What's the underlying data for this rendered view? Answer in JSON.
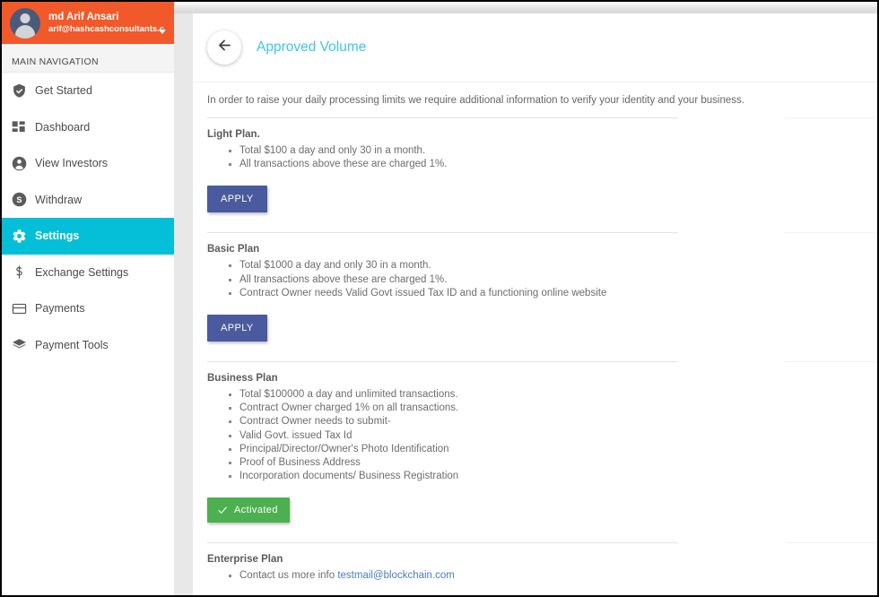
{
  "sidebar": {
    "user": {
      "name": "md Arif Ansari",
      "email": "arif@hashcashconsultants.c",
      "avatar_icon": "user-avatar-icon",
      "caret_icon": "chevron-down-icon"
    },
    "nav_header": "MAIN NAVIGATION",
    "items": [
      {
        "label": "Get Started",
        "icon": "shield-check-icon",
        "active": false
      },
      {
        "label": "Dashboard",
        "icon": "dashboard-grid-icon",
        "active": false
      },
      {
        "label": "View Investors",
        "icon": "user-circle-icon",
        "active": false
      },
      {
        "label": "Withdraw",
        "icon": "dollar-circle-icon",
        "active": false
      },
      {
        "label": "Settings",
        "icon": "gear-icon",
        "active": true
      },
      {
        "label": "Exchange Settings",
        "icon": "dollar-sign-icon",
        "active": false
      },
      {
        "label": "Payments",
        "icon": "credit-card-icon",
        "active": false
      },
      {
        "label": "Payment Tools",
        "icon": "layers-icon",
        "active": false
      }
    ]
  },
  "page": {
    "back_icon": "arrow-left-icon",
    "title": "Approved Volume",
    "intro": "In order to raise your daily processing limits we require additional information to verify your identity and your business."
  },
  "plans": [
    {
      "title": "Light Plan.",
      "bullets": [
        "Total $100 a day and only 30 in a month.",
        "All transactions above these are charged 1%."
      ],
      "action": {
        "type": "apply",
        "label": "APPLY",
        "icon": ""
      }
    },
    {
      "title": "Basic Plan",
      "bullets": [
        "Total $1000 a day and only 30 in a month.",
        "All transactions above these are charged 1%.",
        "Contract Owner needs Valid Govt issued Tax ID and a functioning online website"
      ],
      "action": {
        "type": "apply",
        "label": "APPLY",
        "icon": ""
      }
    },
    {
      "title": "Business Plan",
      "bullets": [
        "Total $100000 a day and unlimited transactions.",
        "Contract Owner charged 1% on all transactions.",
        "Contract Owner needs to submit-",
        "Valid Govt. issued Tax Id",
        "Principal/Director/Owner's Photo Identification",
        "Proof of Business Address",
        "Incorporation documents/ Business Registration"
      ],
      "action": {
        "type": "activated",
        "label": "Activated",
        "icon": "check-icon"
      }
    },
    {
      "title": "Enterprise Plan",
      "bullets_html": [
        {
          "text": "Contact us more info ",
          "link": "testmail@blockchain.com"
        }
      ],
      "action": null
    }
  ],
  "colors": {
    "brand_orange": "#f1592a",
    "active_cyan": "#05bfd8",
    "title_blue": "#40c4e8",
    "apply_button": "#4a5a9e",
    "activated_green": "#4caf50",
    "link_blue": "#4a7ebb"
  }
}
